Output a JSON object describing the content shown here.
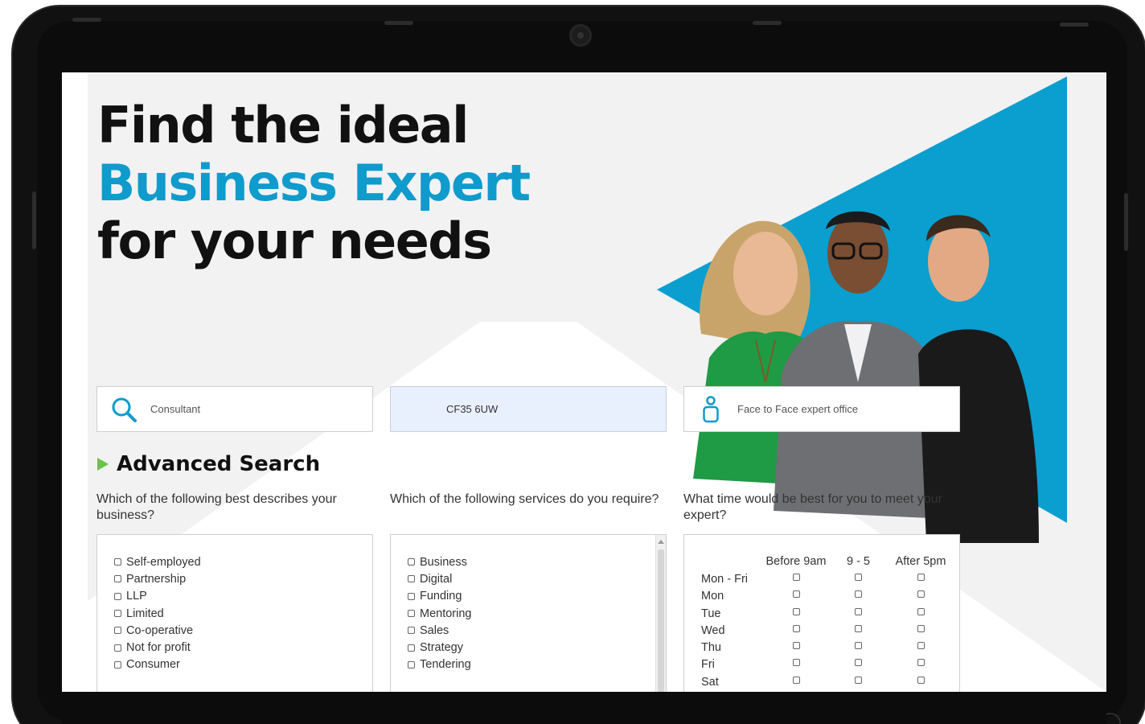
{
  "hero": {
    "line1": "Find the ideal",
    "line2": "Business Expert",
    "line3": "for your needs"
  },
  "search": {
    "keyword_value": "Consultant",
    "postcode_value": "CF35 6UW",
    "meeting_value": "Face to Face expert office"
  },
  "advanced": {
    "title": "Advanced Search",
    "business_type": {
      "question": "Which of the following best describes your business?",
      "options": [
        "Self-employed",
        "Partnership",
        "LLP",
        "Limited",
        "Co-operative",
        "Not for profit",
        "Consumer"
      ]
    },
    "services": {
      "question": "Which of the following services do you require?",
      "options": [
        "Business",
        "Digital",
        "Funding",
        "Mentoring",
        "Sales",
        "Strategy",
        "Tendering"
      ]
    },
    "meeting_time": {
      "question": "What time would be best for you to meet your expert?",
      "columns": [
        "Before 9am",
        "9 - 5",
        "After 5pm"
      ],
      "days": [
        "Mon - Fri",
        "Mon",
        "Tue",
        "Wed",
        "Thu",
        "Fri",
        "Sat"
      ]
    }
  },
  "colors": {
    "accent_blue": "#0f9bcc",
    "panel_blue": "#0a9fcf",
    "arrow_green": "#6cc24a"
  }
}
